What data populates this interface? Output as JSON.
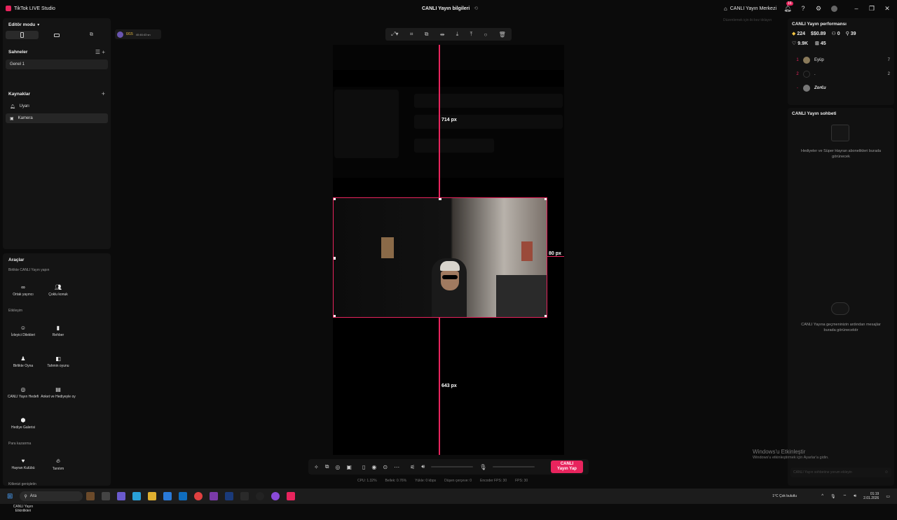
{
  "titlebar": {
    "app_title": "TikTok LIVE Studio",
    "center_title": "CANLI Yayın bilgileri",
    "live_center": "CANLI Yayın Merkezi",
    "notif_count": "16"
  },
  "left": {
    "editor_mode": "Editör modu",
    "scenes_title": "Sahneler",
    "scene_item": "Genel 1",
    "sources_title": "Kaynaklar",
    "sources": [
      "Uyarı",
      "Kamera"
    ]
  },
  "tools": {
    "title": "Araçlar",
    "group1": "Birlikte CANLI Yayın yapın",
    "g1_items": [
      "Ortak yayıncı",
      "Çoklu konuk"
    ],
    "group2": "Etkileşim",
    "g2_items": [
      "İzleyici Dilekleri",
      "Rehber",
      "Birlikte Oyna",
      "Tahmin oyunu",
      "CANLI Yayın Hedefi",
      "Anket ve Hediyeyle oy",
      "Hediye Galerisi"
    ],
    "group3": "Para kazanma",
    "g3_items": [
      "Hayran Kulübü",
      "Tanıtım"
    ],
    "group4": "Kitlenizi genişletin",
    "g4_items": [
      "CANLI Yayın Etkinlikleri"
    ]
  },
  "goal": {
    "value": "0/15",
    "time": "40:46:43 sn"
  },
  "stage": {
    "measure_top": "714 px",
    "measure_right": "80 px",
    "measure_bottom": "643 px"
  },
  "perf": {
    "title": "CANLI Yayın performansı",
    "stats": [
      {
        "icon": "diamond-icon",
        "value": "224"
      },
      {
        "icon": "dollar-icon",
        "value": "$0.89"
      },
      {
        "icon": "users-icon",
        "value": "0"
      },
      {
        "icon": "share-icon",
        "value": "39"
      },
      {
        "icon": "heart-icon",
        "value": "9.9K"
      },
      {
        "icon": "gift-icon",
        "value": "45"
      }
    ],
    "ranking": [
      {
        "rank": "1",
        "name": "Eyüp",
        "score": "7"
      },
      {
        "rank": "2",
        "name": ".",
        "score": "2"
      },
      {
        "rank": "-",
        "name": "Zor€u",
        "score": ""
      }
    ],
    "hint": "Düzenlemek için iki kez tıklayın"
  },
  "chat": {
    "title": "CANLI Yayın sohbeti",
    "gift_msg": "Hediyeler ve Süper Hayran abonelikleri burada görünecek",
    "history_msg": "CANLI Yayına geçmeninizin ardından mesajlar burada görünecektir",
    "input_placeholder": "CANLI Yayın sohbetine yorum ekleyin"
  },
  "bottom": {
    "live_btn": "CANLI Yayın Yap",
    "stats": [
      "CPU: 1.32%",
      "Bellek: 0.76%",
      "Yükle: 0 kbps",
      "Düşen çerçeve: 0",
      "Encoder FPS: 30",
      "FPS: 30"
    ]
  },
  "watermark": {
    "line1": "Windows'u Etkinleştir",
    "line2": "Windows'u etkinleştirmek için Ayarlar'a gidin."
  },
  "taskbar": {
    "search": "Ara",
    "weather": "1°C Çok bulutlu",
    "time": "01:19",
    "date": "2.01.2026"
  },
  "colors": {
    "accent": "#e8245d",
    "bg": "#0b0b0b",
    "panel": "#141414"
  }
}
